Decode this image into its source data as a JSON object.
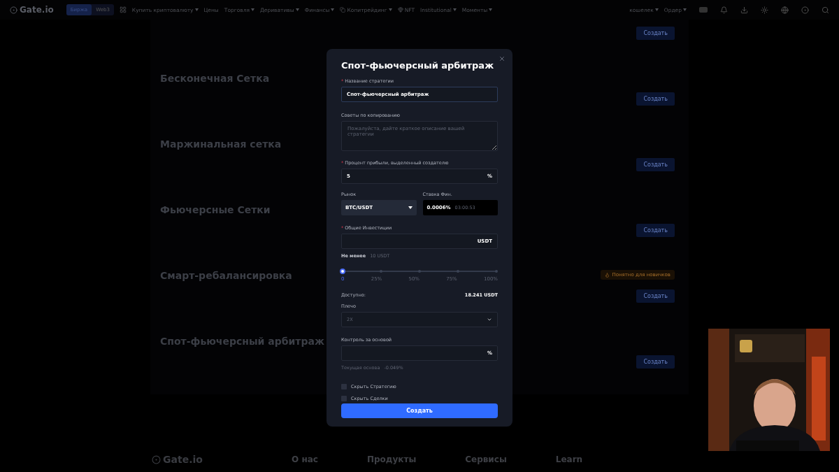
{
  "nav": {
    "logo": "Gate.io",
    "switch": [
      {
        "label": "Биржа",
        "selected": true
      },
      {
        "label": "Web3",
        "selected": false
      }
    ],
    "menu": [
      {
        "label": "Купить криптовалюту",
        "dropdown": true
      },
      {
        "label": "Цены",
        "dropdown": false
      },
      {
        "label": "Торговля",
        "dropdown": true
      },
      {
        "label": "Деривативы",
        "dropdown": true
      },
      {
        "label": "Финансы",
        "dropdown": true
      },
      {
        "label": "Копитрейдинг",
        "dropdown": true
      },
      {
        "label": "NFT",
        "dropdown": false
      },
      {
        "label": "Institutional",
        "dropdown": true
      },
      {
        "label": "Моменты",
        "dropdown": true
      }
    ],
    "account": [
      {
        "label": "кошелек",
        "dropdown": true
      },
      {
        "label": "Ордер",
        "dropdown": true
      }
    ]
  },
  "sections": [
    {
      "button": "Создать"
    },
    {
      "title": "Бесконечная Сетка",
      "button": "Создать"
    },
    {
      "title": "Маржинальная сетка",
      "button": "Создать"
    },
    {
      "title": "Фьючерсные Сетки",
      "button": "Создать"
    },
    {
      "title": "Смарт-ребалансировка",
      "button": "Создать",
      "note": "Понятно для новичков"
    },
    {
      "title": "Спот-фьючерсный арбитраж",
      "button": "Создать"
    }
  ],
  "footer": {
    "logo": "Gate.io",
    "columns": [
      "О нас",
      "Продукты",
      "Сервисы",
      "Learn"
    ]
  },
  "modal": {
    "title": "Спот-фьючерсный арбитраж",
    "name_field": {
      "marker": "*",
      "label": "Название стратегии",
      "value": "Спот-фьючерсный арбитраж"
    },
    "tips_field": {
      "label": "Советы по копированию",
      "placeholder": "Пожалуйста, дайте краткое описание вашей стратегии"
    },
    "profit_field": {
      "marker": "*",
      "label": "Процент прибыли, выделенный создателю",
      "value": "5",
      "suffix": "%"
    },
    "market": {
      "label": "Рынок",
      "value": "BTC/USDT"
    },
    "funding": {
      "label": "Ставка Фин.",
      "rate": "0.0006%",
      "countdown": "03:00:53"
    },
    "investment": {
      "marker": "*",
      "label": "Общие Инвестиции",
      "suffix": "USDT"
    },
    "minimum": {
      "label": "Не менее",
      "value": "10 USDT"
    },
    "slider": {
      "level": 0,
      "marks": [
        "0",
        "25%",
        "50%",
        "75%",
        "100%"
      ]
    },
    "available": {
      "label": "Доступно:",
      "value": "18.241 USDT"
    },
    "leverage": {
      "label": "Плечо",
      "placeholder": "2X"
    },
    "basis": {
      "label": "Контроль за основой",
      "suffix": "%"
    },
    "current_basis": {
      "label": "Текущая основа",
      "value": "-0.049%"
    },
    "options": [
      {
        "label": "Скрыть Стратегию",
        "checked": false
      },
      {
        "label": "Скрыть Сделки",
        "checked": false
      }
    ],
    "submit": "Создать"
  }
}
